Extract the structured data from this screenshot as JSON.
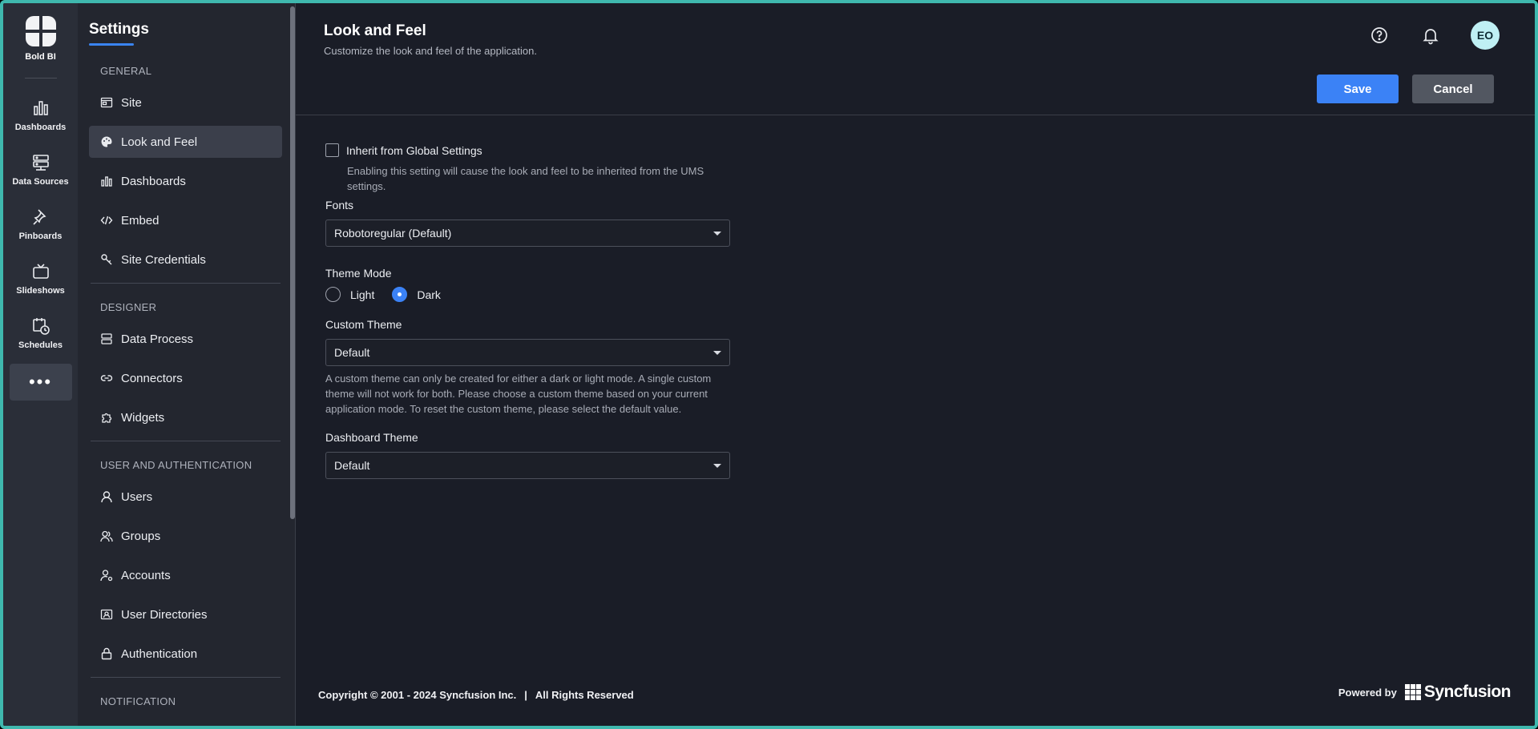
{
  "rail": {
    "brand": "Bold BI",
    "items": [
      {
        "label": "Dashboards",
        "icon": "bar-chart-icon"
      },
      {
        "label": "Data Sources",
        "icon": "server-icon"
      },
      {
        "label": "Pinboards",
        "icon": "pin-icon"
      },
      {
        "label": "Slideshows",
        "icon": "tv-icon"
      },
      {
        "label": "Schedules",
        "icon": "calendar-clock-icon"
      }
    ],
    "more": "•••"
  },
  "panel": {
    "title": "Settings",
    "groups": {
      "general": "GENERAL",
      "designer": "DESIGNER",
      "user_auth": "USER AND AUTHENTICATION",
      "notification": "NOTIFICATION"
    },
    "items": {
      "site": "Site",
      "look_and_feel": "Look and Feel",
      "dashboards": "Dashboards",
      "embed": "Embed",
      "site_credentials": "Site Credentials",
      "data_process": "Data Process",
      "connectors": "Connectors",
      "widgets": "Widgets",
      "users": "Users",
      "groups": "Groups",
      "accounts": "Accounts",
      "user_directories": "User Directories",
      "authentication": "Authentication"
    }
  },
  "header": {
    "title": "Look and Feel",
    "subtitle": "Customize the look and feel of the application.",
    "avatar": "EO"
  },
  "actions": {
    "save": "Save",
    "cancel": "Cancel"
  },
  "form": {
    "inherit_label": "Inherit from Global Settings",
    "inherit_help": "Enabling this setting will cause the look and feel to be inherited from the UMS settings.",
    "fonts_label": "Fonts",
    "fonts_value": "Robotoregular (Default)",
    "theme_mode_label": "Theme Mode",
    "theme_light": "Light",
    "theme_dark": "Dark",
    "theme_selected": "Dark",
    "custom_theme_label": "Custom Theme",
    "custom_theme_value": "Default",
    "custom_theme_help": "A custom theme can only be created for either a dark or light mode. A single custom theme will not work for both. Please choose a custom theme based on your current application mode. To reset the custom theme, please select the default value.",
    "dashboard_theme_label": "Dashboard Theme",
    "dashboard_theme_value": "Default"
  },
  "footer": {
    "copyright": "Copyright © 2001 - 2024 Syncfusion Inc.",
    "separator": "|",
    "rights": "All Rights Reserved",
    "powered_by": "Powered by",
    "brand": "Syncfusion"
  },
  "colors": {
    "accent": "#3b82f6",
    "frame_border": "#3fb8ae",
    "background": "#1a1d27",
    "panel": "#23262f",
    "rail": "#2a2e38"
  }
}
